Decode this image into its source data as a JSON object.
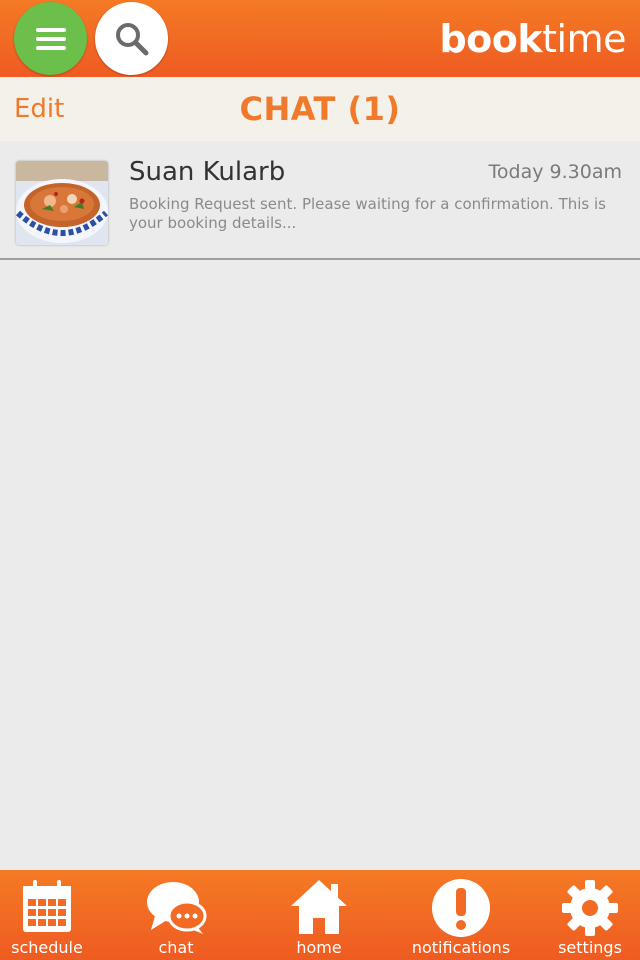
{
  "header": {
    "brand_bold": "book",
    "brand_light": "time",
    "menu_icon": "hamburger-menu-icon",
    "search_icon": "search-icon",
    "accent_color": "#f06a24",
    "menu_color": "#6cbf4a"
  },
  "subheader": {
    "edit_label": "Edit",
    "title": "CHAT (1)"
  },
  "chats": [
    {
      "name": "Suan Kularb",
      "time": "Today 9.30am",
      "preview": "Booking Request sent. Please waiting for a confirmation. This is your booking details...",
      "thumb_icon": "food-bowl-thumbnail"
    }
  ],
  "tabs": [
    {
      "label": "schedule",
      "icon": "calendar-icon"
    },
    {
      "label": "chat",
      "icon": "chat-bubble-icon"
    },
    {
      "label": "home",
      "icon": "home-icon"
    },
    {
      "label": "notifications",
      "icon": "exclamation-icon"
    },
    {
      "label": "settings",
      "icon": "gear-icon"
    }
  ]
}
